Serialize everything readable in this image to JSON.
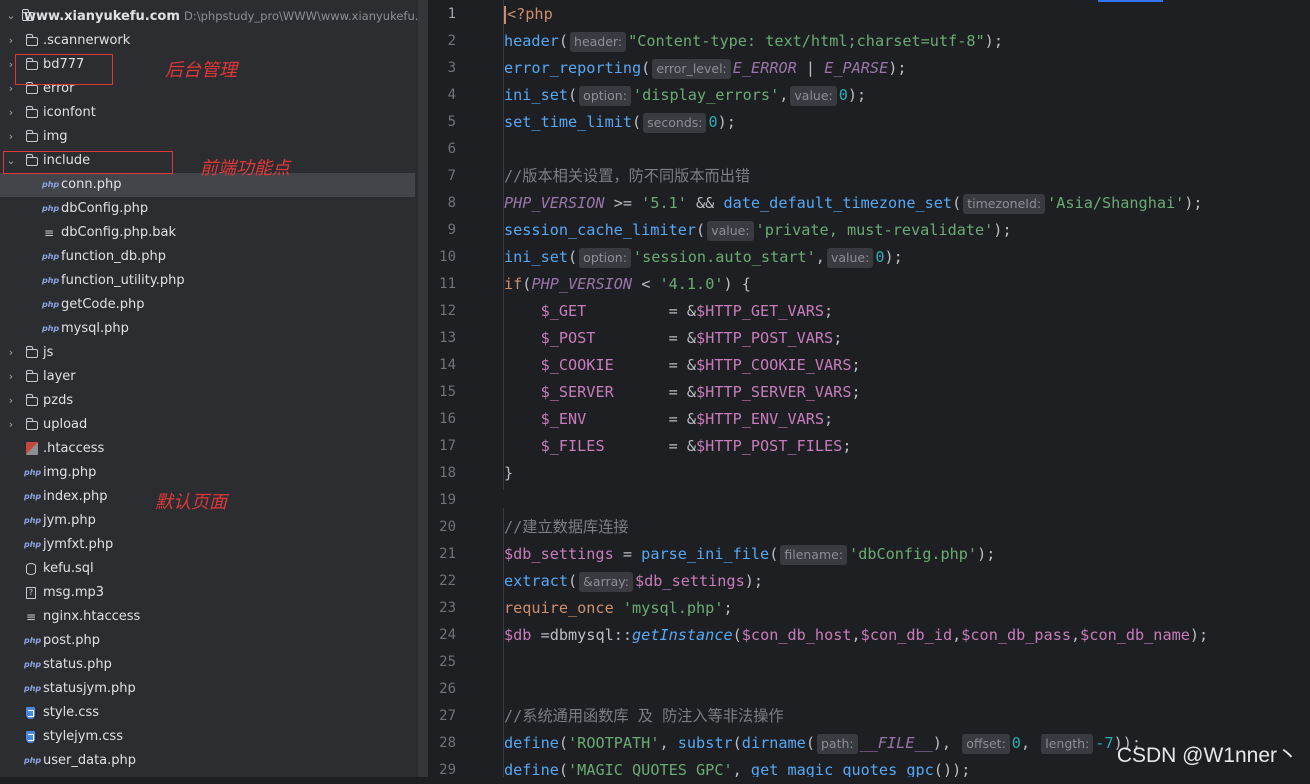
{
  "project": {
    "root_name": "www.xianyukefu.com",
    "root_path": "D:\\phpstudy_pro\\WWW\\www.xianyukefu.com"
  },
  "tree": [
    {
      "name": ".scannerwork",
      "type": "folder",
      "indent": 0,
      "expanded": false,
      "data_name": "folder-scannerwork"
    },
    {
      "name": "bd777",
      "type": "folder",
      "indent": 0,
      "expanded": false,
      "data_name": "folder-bd777"
    },
    {
      "name": "error",
      "type": "folder",
      "indent": 0,
      "expanded": false,
      "data_name": "folder-error"
    },
    {
      "name": "iconfont",
      "type": "folder",
      "indent": 0,
      "expanded": false,
      "data_name": "folder-iconfont"
    },
    {
      "name": "img",
      "type": "folder",
      "indent": 0,
      "expanded": false,
      "data_name": "folder-img"
    },
    {
      "name": "include",
      "type": "folder",
      "indent": 0,
      "expanded": true,
      "data_name": "folder-include"
    },
    {
      "name": "conn.php",
      "type": "php",
      "indent": 1,
      "selected": true,
      "data_name": "file-conn-php"
    },
    {
      "name": "dbConfig.php",
      "type": "php",
      "indent": 1,
      "data_name": "file-dbconfig-php"
    },
    {
      "name": "dbConfig.php.bak",
      "type": "text",
      "indent": 1,
      "data_name": "file-dbconfig-bak"
    },
    {
      "name": "function_db.php",
      "type": "php",
      "indent": 1,
      "data_name": "file-function-db-php"
    },
    {
      "name": "function_utility.php",
      "type": "php",
      "indent": 1,
      "data_name": "file-function-utility-php"
    },
    {
      "name": "getCode.php",
      "type": "php",
      "indent": 1,
      "data_name": "file-getcode-php"
    },
    {
      "name": "mysql.php",
      "type": "php",
      "indent": 1,
      "data_name": "file-mysql-php"
    },
    {
      "name": "js",
      "type": "folder",
      "indent": 0,
      "expanded": false,
      "data_name": "folder-js"
    },
    {
      "name": "layer",
      "type": "folder",
      "indent": 0,
      "expanded": false,
      "data_name": "folder-layer"
    },
    {
      "name": "pzds",
      "type": "folder",
      "indent": 0,
      "expanded": false,
      "data_name": "folder-pzds"
    },
    {
      "name": "upload",
      "type": "folder",
      "indent": 0,
      "expanded": false,
      "data_name": "folder-upload"
    },
    {
      "name": ".htaccess",
      "type": "htaccess",
      "indent": 0,
      "data_name": "file-htaccess"
    },
    {
      "name": "img.php",
      "type": "php",
      "indent": 0,
      "data_name": "file-img-php"
    },
    {
      "name": "index.php",
      "type": "php",
      "indent": 0,
      "data_name": "file-index-php"
    },
    {
      "name": "jym.php",
      "type": "php",
      "indent": 0,
      "data_name": "file-jym-php"
    },
    {
      "name": "jymfxt.php",
      "type": "php",
      "indent": 0,
      "data_name": "file-jymfxt-php"
    },
    {
      "name": "kefu.sql",
      "type": "db",
      "indent": 0,
      "data_name": "file-kefu-sql"
    },
    {
      "name": "msg.mp3",
      "type": "audio",
      "indent": 0,
      "data_name": "file-msg-mp3"
    },
    {
      "name": "nginx.htaccess",
      "type": "text",
      "indent": 0,
      "data_name": "file-nginx-htaccess"
    },
    {
      "name": "post.php",
      "type": "php",
      "indent": 0,
      "data_name": "file-post-php"
    },
    {
      "name": "status.php",
      "type": "php",
      "indent": 0,
      "data_name": "file-status-php"
    },
    {
      "name": "statusjym.php",
      "type": "php",
      "indent": 0,
      "data_name": "file-statusjym-php"
    },
    {
      "name": "style.css",
      "type": "css",
      "indent": 0,
      "data_name": "file-style-css"
    },
    {
      "name": "stylejym.css",
      "type": "css",
      "indent": 0,
      "data_name": "file-stylejym-css"
    },
    {
      "name": "user_data.php",
      "type": "php",
      "indent": 0,
      "data_name": "file-user-data-php"
    }
  ],
  "file_type_labels": {
    "php": "php"
  },
  "annotations": {
    "backend": "后台管理",
    "frontend": "前端功能点",
    "default_page": "默认页面"
  },
  "code_lines": [
    [
      [
        "caret",
        ""
      ],
      [
        "kw",
        "<?php"
      ]
    ],
    [
      [
        "fn",
        "header"
      ],
      [
        "p",
        "("
      ],
      [
        "hint",
        "header:"
      ],
      [
        "str",
        "\"Content-type: text/html;charset=utf-8\""
      ],
      [
        "p",
        ");"
      ]
    ],
    [
      [
        "fn",
        "error_reporting"
      ],
      [
        "p",
        "("
      ],
      [
        "hint",
        "error_level:"
      ],
      [
        "cn",
        "E_ERROR"
      ],
      [
        "p",
        " | "
      ],
      [
        "cn",
        "E_PARSE"
      ],
      [
        "p",
        ");"
      ]
    ],
    [
      [
        "fn",
        "ini_set"
      ],
      [
        "p",
        "("
      ],
      [
        "hint",
        "option:"
      ],
      [
        "str",
        "'display_errors'"
      ],
      [
        "p",
        ","
      ],
      [
        "hint",
        "value:"
      ],
      [
        "num",
        "0"
      ],
      [
        "p",
        ");"
      ]
    ],
    [
      [
        "fn",
        "set_time_limit"
      ],
      [
        "p",
        "("
      ],
      [
        "hint",
        "seconds:"
      ],
      [
        "num",
        "0"
      ],
      [
        "p",
        ");"
      ]
    ],
    [],
    [
      [
        "cmt",
        "//版本相关设置，防不同版本而出错"
      ]
    ],
    [
      [
        "cn",
        "PHP_VERSION"
      ],
      [
        "p",
        " >= "
      ],
      [
        "str",
        "'5.1'"
      ],
      [
        "p",
        " && "
      ],
      [
        "fn",
        "date_default_timezone_set"
      ],
      [
        "p",
        "("
      ],
      [
        "hint",
        "timezoneId:"
      ],
      [
        "str",
        "'Asia/Shanghai'"
      ],
      [
        "p",
        ");"
      ]
    ],
    [
      [
        "fn",
        "session_cache_limiter"
      ],
      [
        "p",
        "("
      ],
      [
        "hint",
        "value:"
      ],
      [
        "str",
        "'private, must-revalidate'"
      ],
      [
        "p",
        ");"
      ]
    ],
    [
      [
        "fn",
        "ini_set"
      ],
      [
        "p",
        "("
      ],
      [
        "hint",
        "option:"
      ],
      [
        "str",
        "'session.auto_start'"
      ],
      [
        "p",
        ","
      ],
      [
        "hint",
        "value:"
      ],
      [
        "num",
        "0"
      ],
      [
        "p",
        ");"
      ]
    ],
    [
      [
        "kw",
        "if"
      ],
      [
        "p",
        "("
      ],
      [
        "cn",
        "PHP_VERSION"
      ],
      [
        "p",
        " < "
      ],
      [
        "str",
        "'4.1.0'"
      ],
      [
        "p",
        ") {"
      ]
    ],
    [
      [
        "p",
        "    "
      ],
      [
        "gv",
        "$_GET"
      ],
      [
        "p",
        "         = &"
      ],
      [
        "var",
        "$HTTP_GET_VARS"
      ],
      [
        "p",
        ";"
      ]
    ],
    [
      [
        "p",
        "    "
      ],
      [
        "gv",
        "$_POST"
      ],
      [
        "p",
        "        = &"
      ],
      [
        "var",
        "$HTTP_POST_VARS"
      ],
      [
        "p",
        ";"
      ]
    ],
    [
      [
        "p",
        "    "
      ],
      [
        "gv",
        "$_COOKIE"
      ],
      [
        "p",
        "      = &"
      ],
      [
        "var",
        "$HTTP_COOKIE_VARS"
      ],
      [
        "p",
        ";"
      ]
    ],
    [
      [
        "p",
        "    "
      ],
      [
        "gv",
        "$_SERVER"
      ],
      [
        "p",
        "      = &"
      ],
      [
        "var",
        "$HTTP_SERVER_VARS"
      ],
      [
        "p",
        ";"
      ]
    ],
    [
      [
        "p",
        "    "
      ],
      [
        "gv",
        "$_ENV"
      ],
      [
        "p",
        "         = &"
      ],
      [
        "var",
        "$HTTP_ENV_VARS"
      ],
      [
        "p",
        ";"
      ]
    ],
    [
      [
        "p",
        "    "
      ],
      [
        "gv",
        "$_FILES"
      ],
      [
        "p",
        "       = &"
      ],
      [
        "var",
        "$HTTP_POST_FILES"
      ],
      [
        "p",
        ";"
      ]
    ],
    [
      [
        "p",
        "}"
      ]
    ],
    [],
    [
      [
        "cmt",
        "//建立数据库连接"
      ]
    ],
    [
      [
        "var",
        "$db_settings"
      ],
      [
        "p",
        " = "
      ],
      [
        "fn",
        "parse_ini_file"
      ],
      [
        "p",
        "("
      ],
      [
        "hint",
        "filename:"
      ],
      [
        "str",
        "'dbConfig.php'"
      ],
      [
        "p",
        ");"
      ]
    ],
    [
      [
        "fn",
        "extract"
      ],
      [
        "p",
        "("
      ],
      [
        "hint",
        "&array:"
      ],
      [
        "var",
        "$db_settings"
      ],
      [
        "p",
        ");"
      ]
    ],
    [
      [
        "kw",
        "require_once"
      ],
      [
        "p",
        " "
      ],
      [
        "str",
        "'mysql.php'"
      ],
      [
        "p",
        ";"
      ]
    ],
    [
      [
        "var",
        "$db"
      ],
      [
        "p",
        " =dbmysql::"
      ],
      [
        "mth",
        "getInstance"
      ],
      [
        "p",
        "("
      ],
      [
        "var",
        "$con_db_host"
      ],
      [
        "p",
        ","
      ],
      [
        "var",
        "$con_db_id"
      ],
      [
        "p",
        ","
      ],
      [
        "var",
        "$con_db_pass"
      ],
      [
        "p",
        ","
      ],
      [
        "var",
        "$con_db_name"
      ],
      [
        "p",
        ");"
      ]
    ],
    [],
    [],
    [
      [
        "cmt",
        "//系统通用函数库 及 防注入等非法操作"
      ]
    ],
    [
      [
        "fn",
        "define"
      ],
      [
        "p",
        "("
      ],
      [
        "str",
        "'ROOTPATH'"
      ],
      [
        "p",
        ", "
      ],
      [
        "fn",
        "substr"
      ],
      [
        "p",
        "("
      ],
      [
        "fn",
        "dirname"
      ],
      [
        "p",
        "("
      ],
      [
        "hint",
        "path:"
      ],
      [
        "cn",
        "__FILE__"
      ],
      [
        "p",
        "), "
      ],
      [
        "hint",
        "offset:"
      ],
      [
        "num",
        "0"
      ],
      [
        "p",
        ", "
      ],
      [
        "hint",
        "length:"
      ],
      [
        "num",
        "-7"
      ],
      [
        "p",
        "));"
      ]
    ],
    [
      [
        "fn",
        "define"
      ],
      [
        "p",
        "("
      ],
      [
        "str",
        "'MAGIC_QUOTES_GPC'"
      ],
      [
        "p",
        ", "
      ],
      [
        "fn",
        "get_magic_quotes_gpc"
      ],
      [
        "p",
        "());"
      ]
    ]
  ],
  "watermark": "CSDN @W1nner丶",
  "colors": {
    "accent": "#3574f0",
    "annotation": "#e0383a",
    "editor_bg": "#1e1f22",
    "sidebar_bg": "#2b2d30"
  }
}
